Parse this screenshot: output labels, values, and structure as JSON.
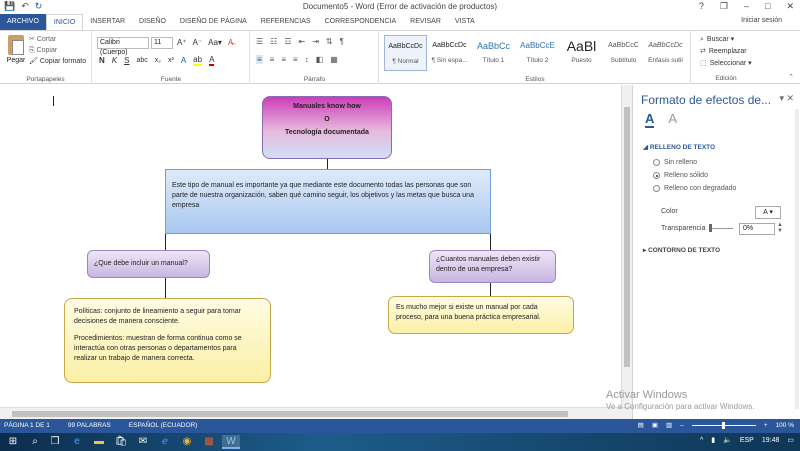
{
  "window": {
    "title": "Documento5 - Word (Error de activación de productos)",
    "qat": {
      "save": "💾",
      "undo": "↶",
      "redo": "↻"
    },
    "controls": {
      "help": "?",
      "restore": "❐",
      "minimize": "–",
      "maximize": "□",
      "close": "✕"
    },
    "signin": "Iniciar sesión"
  },
  "tabs": [
    "ARCHIVO",
    "INICIO",
    "INSERTAR",
    "DISEÑO",
    "DISEÑO DE PÁGINA",
    "REFERENCIAS",
    "CORRESPONDENCIA",
    "REVISAR",
    "VISTA"
  ],
  "ribbon": {
    "clipboard": {
      "label": "Portapapeles",
      "paste": "Pegar",
      "cut": "Cortar",
      "copy": "Copiar",
      "format_painter": "Copiar formato"
    },
    "font": {
      "label": "Fuente",
      "name": "Calibri (Cuerpo)",
      "size": "11"
    },
    "paragraph": {
      "label": "Párrafo"
    },
    "styles": {
      "label": "Estilos",
      "items": [
        {
          "preview": "AaBbCcDc",
          "name": "¶ Normal"
        },
        {
          "preview": "AaBbCcDc",
          "name": "¶ Sin espa..."
        },
        {
          "preview": "AaBbCc",
          "name": "Título 1"
        },
        {
          "preview": "AaBbCcE",
          "name": "Título 2"
        },
        {
          "preview": "AaBl",
          "name": "Puesto"
        },
        {
          "preview": "AaBbCcC",
          "name": "Subtítulo"
        },
        {
          "preview": "AaBbCcDc",
          "name": "Énfasis sutil"
        }
      ]
    },
    "editing": {
      "label": "Edición",
      "find": "Buscar",
      "replace": "Reemplazar",
      "select": "Seleccionar"
    }
  },
  "diagram": {
    "title": [
      "Manuales know how",
      "O",
      "Tecnología documentada"
    ],
    "main": "Este tipo de manual es importante ya que mediante este documento todas las personas que son parte de nuestra organización, saben qué camino seguir, los objetivos y las metas que busca una empresa",
    "q1": "¿Que debe incluir un manual?",
    "q2": "¿Cuantos manuales deben existir dentro de una empresa?",
    "a1_p1": "Políticas:  conjunto de lineamiento a seguir para tomar decisiones de manera consciente.",
    "a1_p2": "Procedimientos: muestran de forma continua como se interactúa con otras personas o departamentos para realizar un trabajo de manera correcta.",
    "a2": "Es mucho mejor si existe un manual por cada proceso, para una buena práctica empresarial."
  },
  "panel": {
    "title": "Formato de efectos de...",
    "fill_section": "RELLENO DE TEXTO",
    "options": [
      "Sin relleno",
      "Relleno sólido",
      "Relleno con degradado"
    ],
    "color_label": "Color",
    "transparency_label": "Transparencia",
    "transparency_value": "0%",
    "outline_section": "CONTORNO DE TEXTO"
  },
  "watermark": {
    "line1": "Activar Windows",
    "line2": "Ve a Configuración para activar Windows."
  },
  "status": {
    "page": "PÁGINA 1 DE 1",
    "words": "99 PALABRAS",
    "lang": "ESPAÑOL (ECUADOR)",
    "zoom": "100 %"
  },
  "taskbar": {
    "time": "19:48",
    "lang": "ESP"
  }
}
